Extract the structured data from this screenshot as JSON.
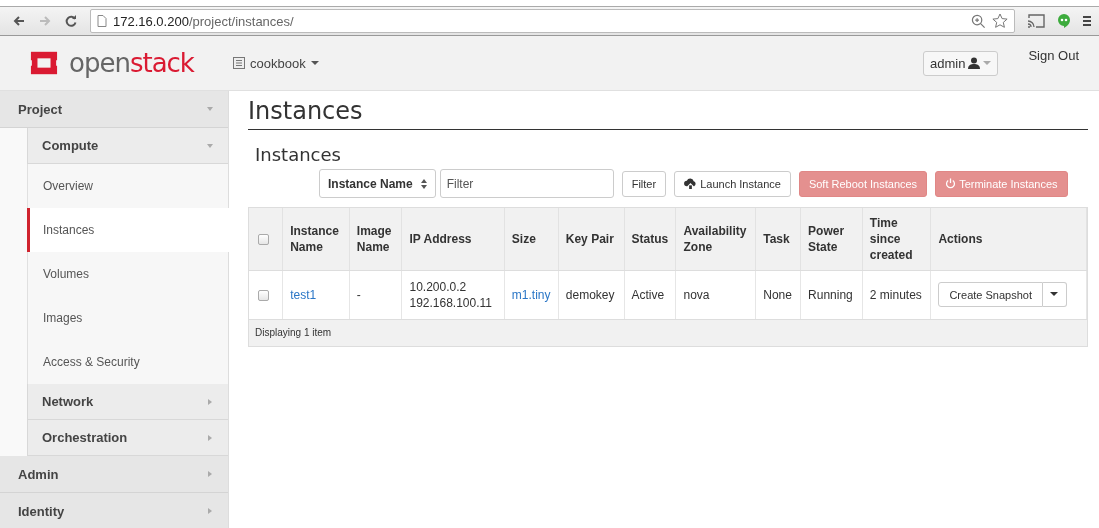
{
  "browser": {
    "url_host": "172.16.0.200",
    "url_path": "/project/instances/"
  },
  "header": {
    "brand_left": "open",
    "brand_right": "stack",
    "project": "cookbook",
    "user": "admin",
    "sign_out": "Sign Out"
  },
  "sidebar": [
    {
      "label": "Project",
      "expanded": true,
      "children": [
        {
          "label": "Compute",
          "expanded": true,
          "children": [
            {
              "label": "Overview",
              "selected": false
            },
            {
              "label": "Instances",
              "selected": true
            },
            {
              "label": "Volumes",
              "selected": false
            },
            {
              "label": "Images",
              "selected": false
            },
            {
              "label": "Access & Security",
              "selected": false
            }
          ]
        },
        {
          "label": "Network",
          "expanded": false
        },
        {
          "label": "Orchestration",
          "expanded": false
        }
      ]
    },
    {
      "label": "Admin",
      "expanded": false
    },
    {
      "label": "Identity",
      "expanded": false
    }
  ],
  "page_title": "Instances",
  "section_title": "Instances",
  "toolbar": {
    "filter_field": "Instance Name",
    "filter_placeholder": "Filter",
    "buttons": [
      {
        "label": "Filter",
        "kind": "filter",
        "disabled": false
      },
      {
        "label": "Launch Instance",
        "kind": "launch",
        "disabled": false
      },
      {
        "label": "Soft Reboot Instances",
        "kind": "reboot",
        "disabled": true
      },
      {
        "label": "Terminate Instances",
        "kind": "terminate",
        "disabled": true
      }
    ]
  },
  "table": {
    "columns": [
      "Instance Name",
      "Image Name",
      "IP Address",
      "Size",
      "Key Pair",
      "Status",
      "Availability Zone",
      "Task",
      "Power State",
      "Time since created",
      "Actions"
    ],
    "header_checked": false,
    "rows": [
      {
        "checked": false,
        "instance_name": "test1",
        "image_name": "-",
        "ip_address": [
          "10.200.0.2",
          "192.168.100.11"
        ],
        "size": "m1.tiny",
        "key_pair": "demokey",
        "status": "Active",
        "availability_zone": "nova",
        "task": "None",
        "power_state": "Running",
        "time_since_created": "2 minutes",
        "action": "Create Snapshot"
      }
    ],
    "footer": "Displaying 1 item"
  }
}
